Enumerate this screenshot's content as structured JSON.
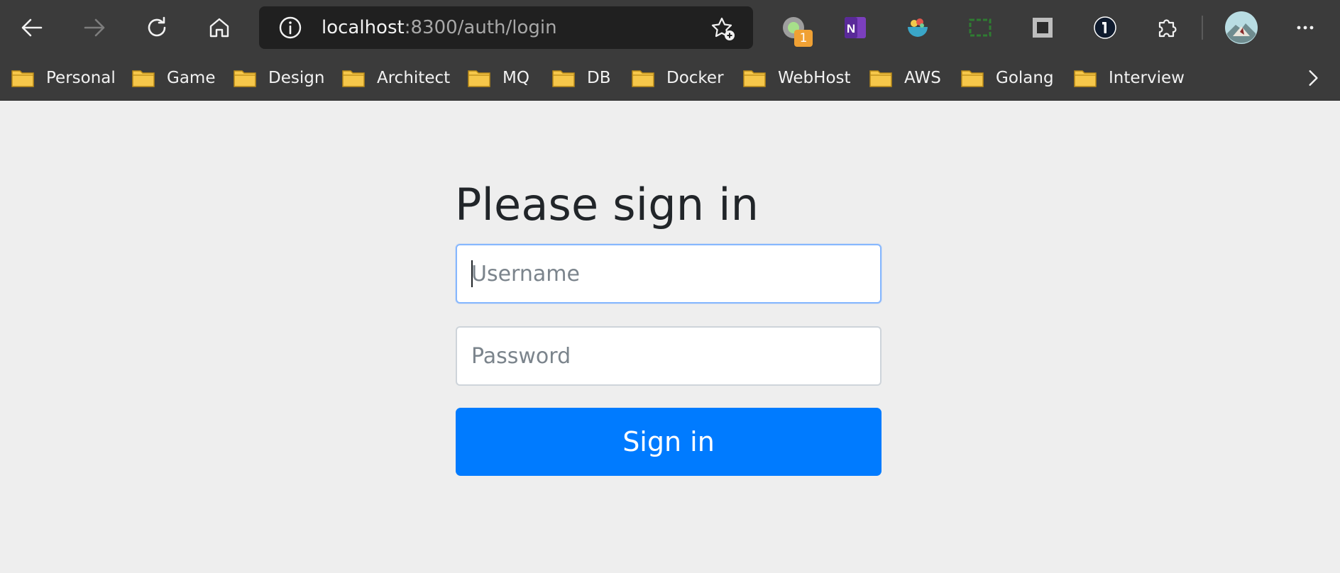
{
  "browser": {
    "address": {
      "host": "localhost",
      "path": ":8300/auth/login"
    },
    "extensions": {
      "badge_count": "1"
    },
    "bookmarks": [
      {
        "label": "Personal"
      },
      {
        "label": "Game"
      },
      {
        "label": "Design"
      },
      {
        "label": "Architect"
      },
      {
        "label": "MQ"
      },
      {
        "label": "DB"
      },
      {
        "label": "Docker"
      },
      {
        "label": "WebHost"
      },
      {
        "label": "AWS"
      },
      {
        "label": "Golang"
      },
      {
        "label": "Interview"
      }
    ]
  },
  "login": {
    "title": "Please sign in",
    "username_placeholder": "Username",
    "password_placeholder": "Password",
    "submit_label": "Sign in"
  },
  "colors": {
    "primary": "#007bff",
    "chrome": "#3b3b3b",
    "page_bg": "#eeeeee",
    "folder": "#f6c74a"
  }
}
